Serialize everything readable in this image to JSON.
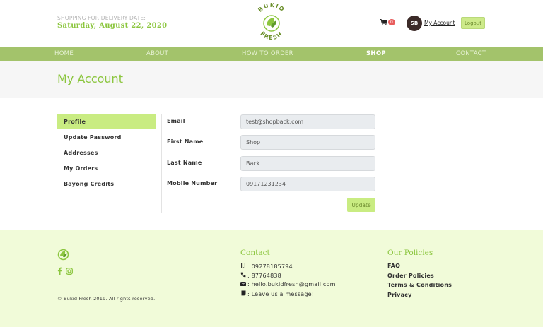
{
  "header": {
    "delivery_caption": "SHOPPING FOR DELIVERY DATE:",
    "delivery_date": "Saturday, August 22, 2020",
    "logo_text_top": "BUKID",
    "logo_text_bottom": "FRESH",
    "cart_count": "0",
    "avatar_initials": "SB",
    "my_account_label": "My Account",
    "logout_label": "Logout"
  },
  "nav": {
    "items": [
      {
        "label": "HOME"
      },
      {
        "label": "ABOUT"
      },
      {
        "label": "HOW TO ORDER"
      },
      {
        "label": "SHOP"
      },
      {
        "label": "CONTACT"
      }
    ],
    "active": "SHOP"
  },
  "page": {
    "title": "My Account"
  },
  "sidebar": {
    "items": [
      {
        "label": "Profile"
      },
      {
        "label": "Update Password"
      },
      {
        "label": "Addresses"
      },
      {
        "label": "My Orders"
      },
      {
        "label": "Bayong Credits"
      }
    ],
    "active": "Profile"
  },
  "form": {
    "fields": [
      {
        "label": "Email",
        "value": "test@shopback.com"
      },
      {
        "label": "First Name",
        "value": "Shop"
      },
      {
        "label": "Last Name",
        "value": "Back"
      },
      {
        "label": "Mobile Number",
        "value": "09171231234"
      }
    ],
    "update_label": "Update"
  },
  "footer": {
    "contact_heading": "Contact",
    "contact": [
      {
        "icon": "mobile-icon",
        "text": ": 09278185794"
      },
      {
        "icon": "phone-icon",
        "text": ": 87764838"
      },
      {
        "icon": "envelope-icon",
        "text": ": hello.bukidfresh@gmail.com"
      },
      {
        "icon": "message-icon",
        "text": ": Leave us a message!"
      }
    ],
    "policies_heading": "Our Policies",
    "policies": [
      {
        "label": "FAQ"
      },
      {
        "label": "Order Policies"
      },
      {
        "label": "Terms & Conditions"
      },
      {
        "label": "Privacy"
      }
    ],
    "copyright": "© Bukid Fresh 2019. All rights reserved."
  },
  "colors": {
    "accent": "#8cc63f",
    "nav_bg": "#a3c36b",
    "button_bg": "#c9ec82",
    "footer_bg": "#f1fbd9",
    "badge": "#e85d5d"
  }
}
